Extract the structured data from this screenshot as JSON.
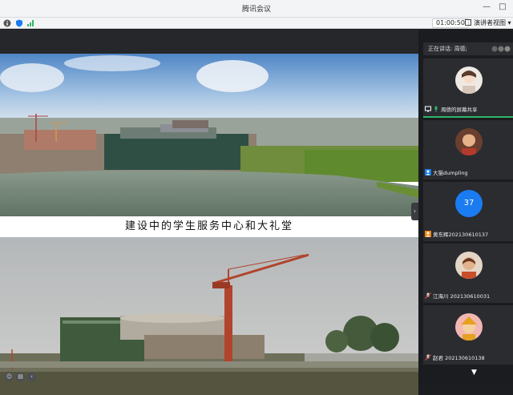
{
  "window": {
    "title": "腾讯会议",
    "minimize": "—",
    "maximize": "□"
  },
  "toolbar": {
    "timer": "01:00:50",
    "view_label": "演讲者视图"
  },
  "slide": {
    "caption": "建设中的学生服务中心和大礼堂"
  },
  "panel": {
    "speaking_label": "正在讲话: 周德;",
    "participants": [
      {
        "name": "周德的屏幕共享",
        "status": "sharing"
      },
      {
        "name": "大猫dumpling",
        "status": "video"
      },
      {
        "name": "黄东辉2021306101​37",
        "status": "no-video",
        "avatar_text": "37"
      },
      {
        "name": "江海川 2021306100​31",
        "status": "muted"
      },
      {
        "name": "赵君 2021306101​38",
        "status": "muted"
      }
    ]
  },
  "colors": {
    "accent": "#1a7cf0",
    "speaking": "#2fb56a"
  }
}
